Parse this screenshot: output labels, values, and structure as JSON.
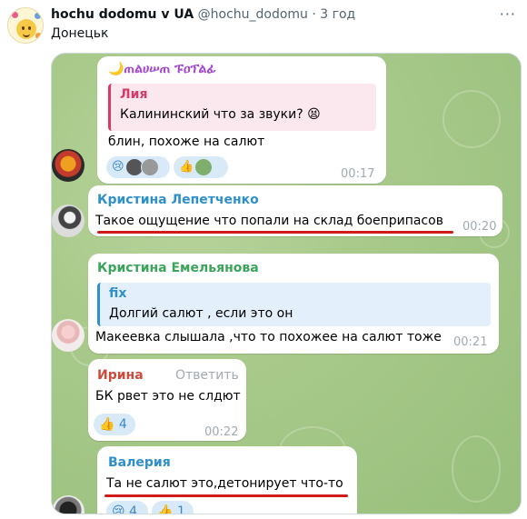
{
  "tweet": {
    "author_name": "hochu dodomu v UA",
    "handle": "@hochu_dodomu",
    "separator": "·",
    "time": "3 год",
    "more": "···",
    "text": "Донецьк"
  },
  "chat": {
    "messages": [
      {
        "sender": "🌙ጠልሀሠጠ ፑዐፕልፊ",
        "sender_color": "#a347d1",
        "quote": {
          "name": "Лия",
          "text": "Калининский что за звуки? 😫",
          "color": "#d63a66",
          "bg": "#fbe8ee"
        },
        "text": "блин, похоже на салют",
        "reactions": {
          "first": "😢",
          "second": "👍"
        },
        "time": "00:17"
      },
      {
        "sender": "Кристина Лепетченко",
        "sender_color": "#2f8fc9",
        "text": "Такое ощущение что попали на склад боеприпасов",
        "time": "00:20"
      },
      {
        "sender": "Кристина Емельянова",
        "sender_color": "#3aa55a",
        "quote": {
          "name": "fix",
          "text": "Долгий салют , если это он",
          "color": "#2f8fc9",
          "bg": "#e3f0fb"
        },
        "text": "Макеевка слышала ,что то похожее на салют тоже",
        "time": "00:21"
      },
      {
        "sender": "Ирина",
        "sender_color": "#cc4b3b",
        "reply_label": "Ответить",
        "text": "БК рвет это не слдют",
        "reaction": {
          "emoji": "👍",
          "count": "4"
        },
        "time": "00:22"
      },
      {
        "sender": "Валерия",
        "sender_color": "#2f8fc9",
        "text": "Та не салют это,детонирует что-то",
        "reactions": [
          {
            "emoji": "😢",
            "count": "4"
          },
          {
            "emoji": "👍",
            "count": "1"
          }
        ]
      }
    ]
  },
  "colors": {
    "underline": "#d11a1a",
    "reaction_bg": "#d8e9f8",
    "reaction_text": "#3a87c9",
    "chat_bg": "#a8c98a"
  }
}
